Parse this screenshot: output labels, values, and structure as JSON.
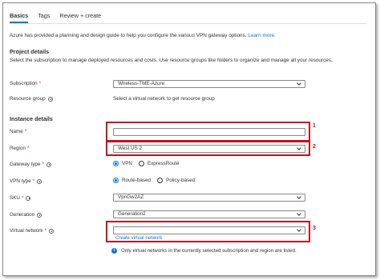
{
  "tabs": [
    {
      "label": "Basics",
      "active": true
    },
    {
      "label": "Tags",
      "active": false
    },
    {
      "label": "Review + create",
      "active": false
    }
  ],
  "intro": {
    "text": "Azure has provided a planning and design guide to help you configure the various VPN gateway options.",
    "link": "Learn more."
  },
  "project_details": {
    "heading": "Project details",
    "description": "Select the subscription to manage deployed resources and costs. Use resource groups like folders to organize and manage all your resources.",
    "subscription_label": "Subscription",
    "subscription_value": "Wireless-TME-Azure",
    "resource_group_label": "Resource group",
    "resource_group_value": "Select a virtual network to get resource group"
  },
  "instance_details": {
    "heading": "Instance details",
    "name_label": "Name",
    "name_value": "",
    "region_label": "Region",
    "region_value": "West US 2",
    "gateway_type_label": "Gateway type",
    "gateway_type_options": [
      "VPN",
      "ExpressRoute"
    ],
    "gateway_type_selected": "VPN",
    "vpn_type_label": "VPN type",
    "vpn_type_options": [
      "Route-based",
      "Policy-based"
    ],
    "vpn_type_selected": "Route-based",
    "sku_label": "SKU",
    "sku_value": "VpnGw2AZ",
    "generation_label": "Generation",
    "generation_value": "Generation2",
    "virtual_network_label": "Virtual network",
    "virtual_network_value": "",
    "create_vnet_link": "Create virtual network",
    "note": "Only virtual networks in the currently selected subscription and region are listed."
  },
  "required_marker": "*",
  "callouts": [
    "1",
    "2",
    "3"
  ],
  "colors": {
    "accent": "#0078d4",
    "highlight": "#c50f1f",
    "required": "#a4262c"
  }
}
